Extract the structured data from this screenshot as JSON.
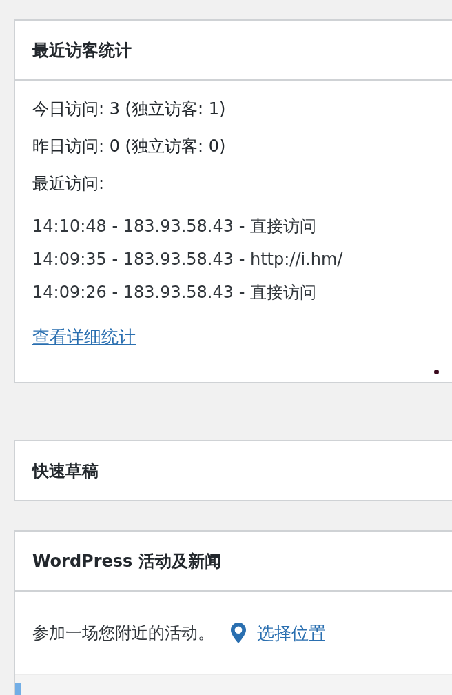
{
  "widgets": [
    {
      "kind": "stats",
      "title": "最近访客统计",
      "summary": [
        "今日访问: 3 (独立访客: 1)",
        "昨日访问: 0 (独立访客: 0)",
        "最近访问:"
      ],
      "visits": [
        "14:10:48 - 183.93.58.43 - 直接访问",
        "14:09:35 - 183.93.58.43 - http://i.hm/",
        "14:09:26 - 183.93.58.43 - 直接访问"
      ],
      "link": "查看详细统计"
    },
    {
      "kind": "collapsed",
      "title": "快速草稿"
    },
    {
      "kind": "events",
      "title": "WordPress 活动及新闻",
      "prompt": "参加一场您附近的活动。",
      "location_link": "选择位置"
    }
  ]
}
